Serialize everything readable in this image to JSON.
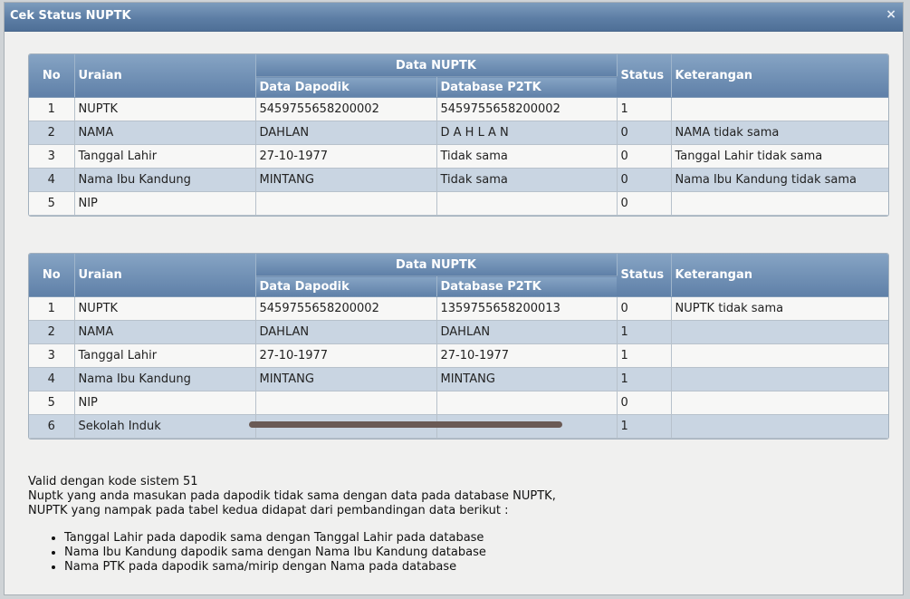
{
  "dialog": {
    "title": "Cek Status NUPTK",
    "close_glyph": "×"
  },
  "table_headers": {
    "no": "No",
    "uraian": "Uraian",
    "data_nuptk": "Data NUPTK",
    "data_dapodik": "Data Dapodik",
    "database_p2tk": "Database P2TK",
    "status": "Status",
    "keterangan": "Keterangan"
  },
  "table1": {
    "rows": [
      [
        "1",
        "NUPTK",
        "5459755658200002",
        "5459755658200002",
        "1",
        ""
      ],
      [
        "2",
        "NAMA",
        "DAHLAN",
        "D A H L A N",
        "0",
        "NAMA tidak sama"
      ],
      [
        "3",
        "Tanggal Lahir",
        "27-10-1977",
        "Tidak sama",
        "0",
        "Tanggal Lahir tidak sama"
      ],
      [
        "4",
        "Nama Ibu Kandung",
        "MINTANG",
        "Tidak sama",
        "0",
        "Nama Ibu Kandung tidak sama"
      ],
      [
        "5",
        "NIP",
        "",
        "",
        "0",
        ""
      ]
    ]
  },
  "table2": {
    "rows": [
      [
        "1",
        "NUPTK",
        "5459755658200002",
        "1359755658200013",
        "0",
        "NUPTK tidak sama"
      ],
      [
        "2",
        "NAMA",
        "DAHLAN",
        "DAHLAN",
        "1",
        ""
      ],
      [
        "3",
        "Tanggal Lahir",
        "27-10-1977",
        "27-10-1977",
        "1",
        ""
      ],
      [
        "4",
        "Nama Ibu Kandung",
        "MINTANG",
        "MINTANG",
        "1",
        ""
      ],
      [
        "5",
        "NIP",
        "",
        "",
        "0",
        ""
      ],
      [
        "6",
        "Sekolah Induk",
        "",
        "",
        "1",
        ""
      ]
    ]
  },
  "notes": {
    "lines": [
      "Valid dengan kode sistem 51",
      "Nuptk yang anda masukan pada dapodik tidak sama dengan data pada database NUPTK,",
      "NUPTK yang nampak pada tabel kedua didapat dari pembandingan data berikut :"
    ],
    "bullets": [
      "Tanggal Lahir pada dapodik sama dengan Tanggal Lahir pada database",
      "Nama Ibu Kandung dapodik sama dengan Nama Ibu Kandung database",
      "Nama PTK pada dapodik sama/mirip dengan Nama pada database"
    ]
  },
  "colors": {
    "header_top": "#86a4c4",
    "header_bottom": "#5f80a8",
    "row_alt": "#c9d5e2",
    "title_bar": "#5d7ea5"
  }
}
